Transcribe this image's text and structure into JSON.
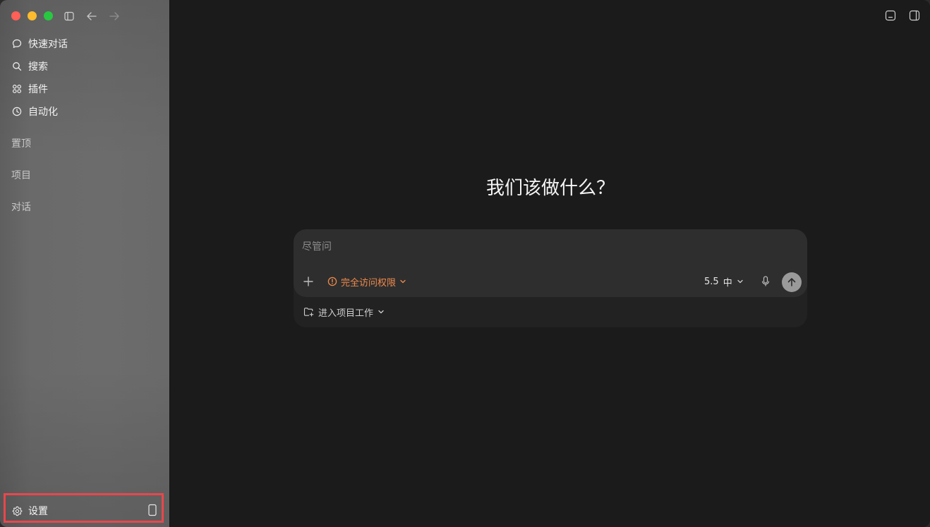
{
  "sidebar": {
    "nav_items": [
      {
        "label": "快速对话",
        "icon": "chat-bubble-icon"
      },
      {
        "label": "搜索",
        "icon": "search-icon"
      },
      {
        "label": "插件",
        "icon": "plugins-grid-icon"
      },
      {
        "label": "自动化",
        "icon": "clock-icon"
      }
    ],
    "sections": {
      "pinned": "置顶",
      "projects": "项目",
      "conversations": "对话"
    },
    "settings_label": "设置"
  },
  "main": {
    "headline": "我们该做什么？",
    "composer": {
      "placeholder": "尽管问",
      "permission_label": "完全访问权限",
      "model_version": "5.5",
      "model_level": "中",
      "project_label": "进入项目工作"
    }
  },
  "colors": {
    "accent_orange": "#f08a4b",
    "highlight_red": "#e8474c"
  }
}
